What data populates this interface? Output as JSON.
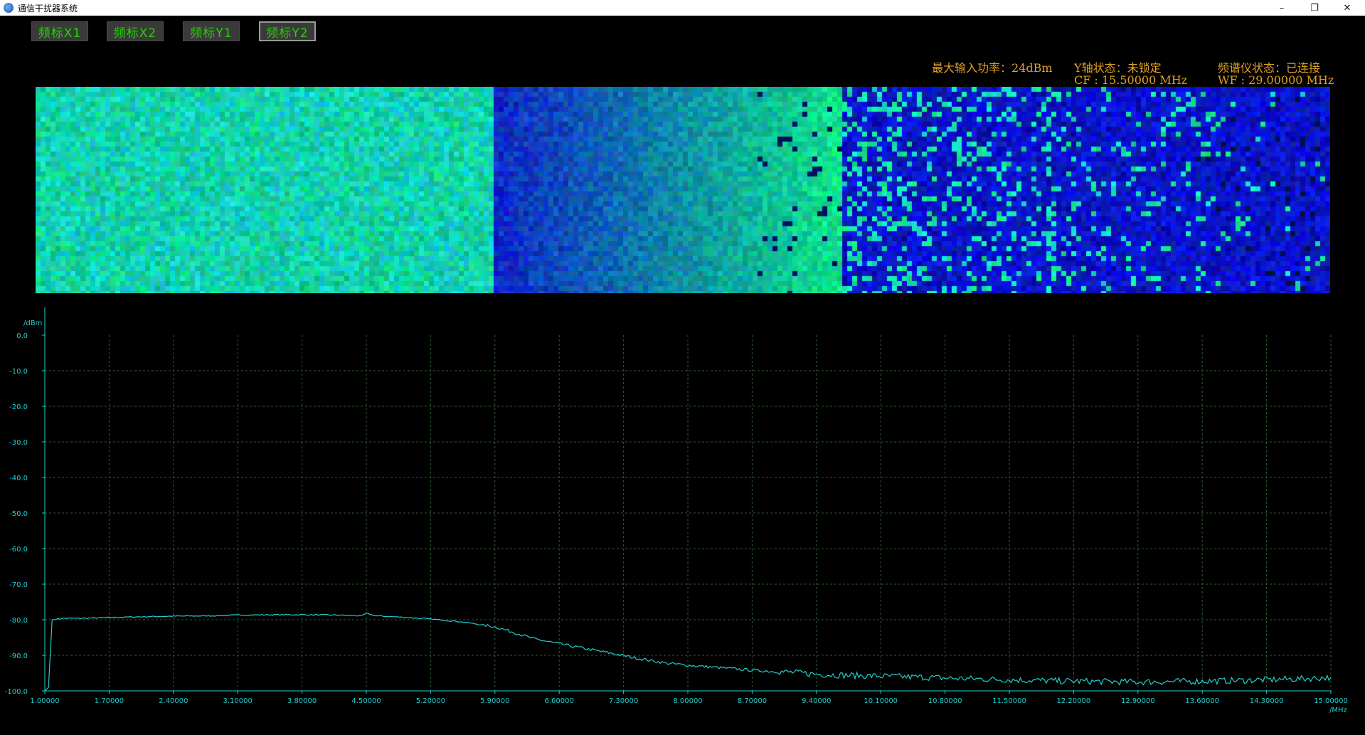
{
  "window": {
    "title": "通信干扰器系统",
    "minimize": "–",
    "maximize": "❐",
    "close": "✕"
  },
  "toolbar": {
    "buttons": [
      {
        "label": "频标X1",
        "active": false
      },
      {
        "label": "频标X2",
        "active": false
      },
      {
        "label": "频标Y1",
        "active": false
      },
      {
        "label": "频标Y2",
        "active": true
      }
    ]
  },
  "status": {
    "max_input_power": "最大输入功率：24dBm",
    "y_axis_state": "Y轴状态：未锁定",
    "cf": "CF : 15.50000 MHz",
    "analyzer_state": "频谱仪状态：已连接",
    "wf": "WF : 29.00000 MHz"
  },
  "colors": {
    "trace": "#20d0d0",
    "axis": "#20d0d0",
    "grid": "#2e5a2e",
    "status_text": "#e0a020",
    "button_text": "#22d400"
  },
  "chart_data": {
    "type": "line",
    "title": "",
    "xlabel": "/MHz",
    "ylabel": "/dBm",
    "xlim": [
      1.0,
      15.0
    ],
    "ylim": [
      -100.0,
      0.0
    ],
    "grid": true,
    "x_tick_labels": [
      "1.00000",
      "1.70000",
      "2.40000",
      "3.10000",
      "3.80000",
      "4.50000",
      "5.20000",
      "5.90000",
      "6.60000",
      "7.30000",
      "8.00000",
      "8.70000",
      "9.40000",
      "10.10000",
      "10.80000",
      "11.50000",
      "12.20000",
      "12.90000",
      "13.60000",
      "14.30000",
      "15.00000"
    ],
    "y_tick_labels": [
      "0.0",
      "-10.0",
      "-20.0",
      "-30.0",
      "-40.0",
      "-50.0",
      "-60.0",
      "-70.0",
      "-80.0",
      "-90.0",
      "-100.0"
    ],
    "series": [
      {
        "x": [
          1.0,
          1.04,
          1.08,
          1.2,
          1.4,
          1.7,
          2.0,
          2.4,
          2.8,
          3.1,
          3.5,
          3.8,
          4.2,
          4.45,
          4.5,
          4.6,
          4.9,
          5.2,
          5.5,
          5.7,
          5.9,
          6.1,
          6.3,
          6.6,
          6.9,
          7.2,
          7.4,
          7.6,
          7.8,
          8.0,
          8.3,
          8.6,
          8.9,
          9.2,
          9.4,
          9.7,
          10.0,
          10.3,
          10.6,
          10.8,
          11.1,
          11.4,
          11.7,
          12.0,
          12.3,
          12.6,
          12.9,
          13.2,
          13.5,
          13.8,
          14.1,
          14.4,
          14.7,
          15.0
        ],
        "y": [
          -100.0,
          -99.0,
          -80.0,
          -79.6,
          -79.6,
          -79.4,
          -79.2,
          -79.0,
          -78.9,
          -78.7,
          -78.6,
          -78.6,
          -78.7,
          -78.9,
          -78.2,
          -78.9,
          -79.3,
          -79.8,
          -80.5,
          -81.2,
          -82.0,
          -83.5,
          -85.2,
          -86.8,
          -88.2,
          -89.6,
          -90.6,
          -91.5,
          -92.3,
          -92.8,
          -93.4,
          -94.0,
          -94.5,
          -94.9,
          -95.3,
          -95.6,
          -95.8,
          -96.0,
          -96.2,
          -96.4,
          -96.6,
          -96.8,
          -97.0,
          -97.2,
          -97.3,
          -97.4,
          -97.5,
          -97.4,
          -97.3,
          -97.2,
          -97.0,
          -96.8,
          -96.6,
          -96.2
        ]
      }
    ]
  }
}
